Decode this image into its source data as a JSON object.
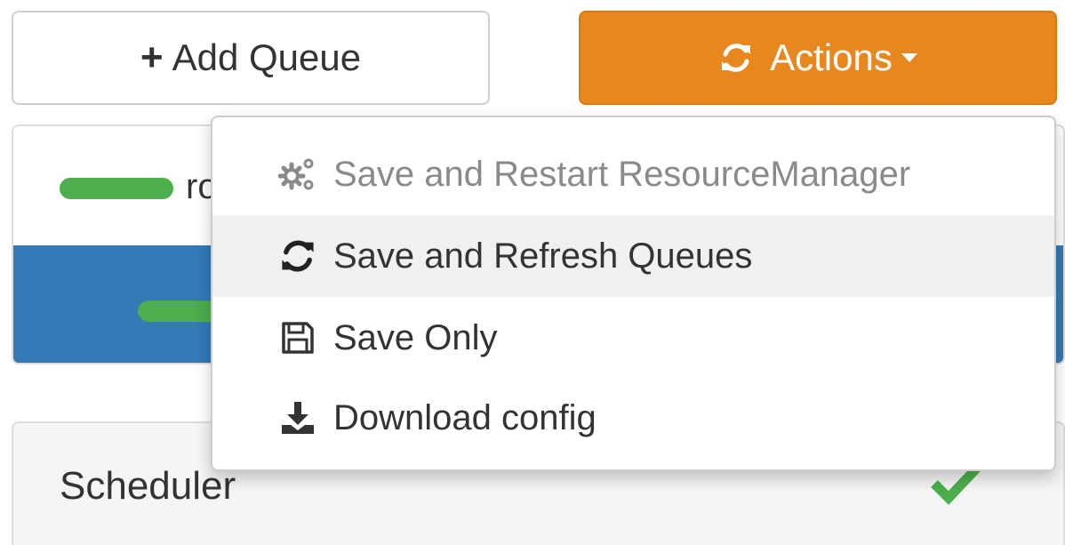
{
  "toolbar": {
    "add_queue_label": "Add Queue",
    "actions_label": "Actions",
    "actions_color": "#e8871e"
  },
  "queues": {
    "root_label": "ro",
    "bar_color": "#4cae4c",
    "selected_color": "#337ab7"
  },
  "actions_menu": {
    "items": [
      {
        "label": "Save and Restart ResourceManager",
        "icon": "gears-icon",
        "disabled": true
      },
      {
        "label": "Save and Refresh Queues",
        "icon": "refresh-icon",
        "active": true
      },
      {
        "label": "Save Only",
        "icon": "floppy-disk-icon"
      },
      {
        "label": "Download config",
        "icon": "download-icon"
      }
    ]
  },
  "scheduler": {
    "title": "Scheduler",
    "status_icon": "check-icon",
    "status_color": "#4cae4c"
  }
}
